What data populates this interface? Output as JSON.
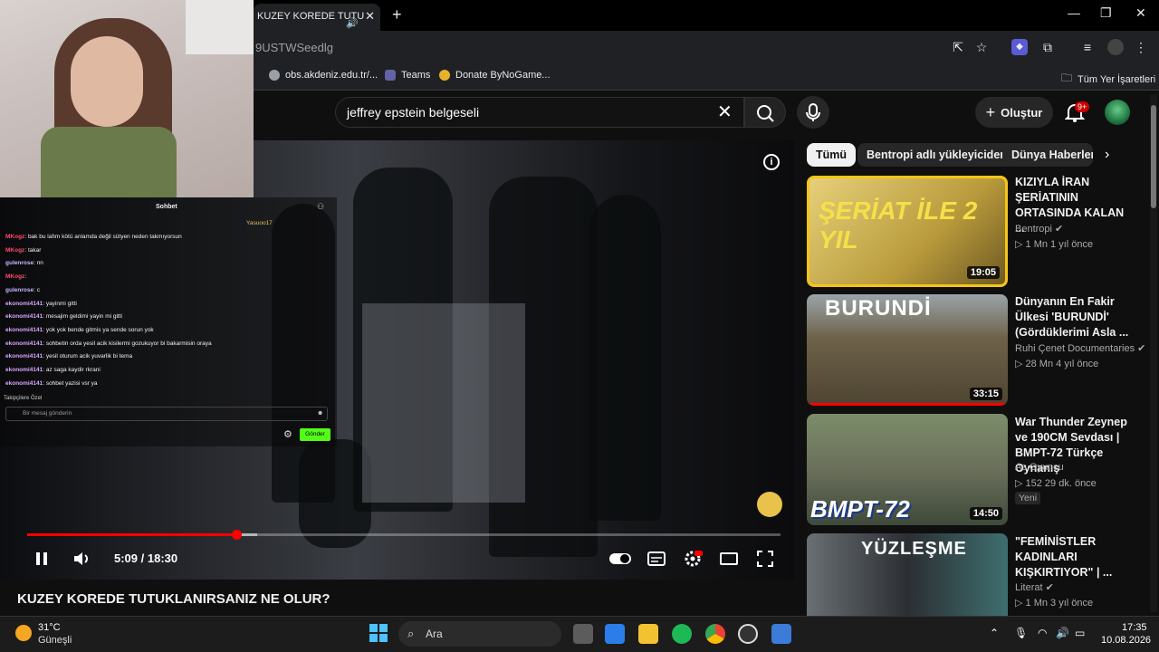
{
  "browser": {
    "tab_title": "KUZEY KOREDE TUTU",
    "url_fragment": "9USTWSeedlg",
    "bookmarks": [
      "obs.akdeniz.edu.tr/...",
      "Teams",
      "Donate ByNoGame..."
    ],
    "all_bookmarks": "Tüm Yer İşaretleri"
  },
  "youtube": {
    "search_query": "jeffrey epstein belgeseli",
    "create_label": "Oluştur",
    "notification_badge": "9+",
    "filter_chips": [
      "Tümü",
      "Bentropi adlı yükleyiciden",
      "Dünya Haberleri"
    ]
  },
  "player": {
    "current_time": "5:09 / 18:30",
    "progress_fraction": 0.278,
    "buffer_fraction": 0.305,
    "video_title": "KUZEY KOREDE TUTUKLANIRSANIZ NE OLUR?"
  },
  "chat": {
    "title": "Sohbet",
    "badge_user": "Yasuoo17",
    "messages": [
      {
        "user": "MKogz",
        "text": "bak bu lafım kötü anlamda değil sütyen neden takmıyorsun",
        "color": "#ff4d6d"
      },
      {
        "user": "MKogz",
        "text": "takar",
        "color": "#ff4d6d"
      },
      {
        "user": "gulenrose",
        "text": "nn",
        "color": "#c7b8ff"
      },
      {
        "user": "MKogz",
        "text": "",
        "color": "#ff4d6d"
      },
      {
        "user": "gulenrose",
        "text": "c",
        "color": "#c7b8ff"
      },
      {
        "user": "ekonomi4141",
        "text": "yayinmi gitti",
        "color": "#d8a6ff"
      },
      {
        "user": "ekonomi4141",
        "text": "mesajim geldimi yayin mi gitti",
        "color": "#d8a6ff"
      },
      {
        "user": "ekonomi4141",
        "text": "yok yok bende gitmis ya sende sorun yok",
        "color": "#d8a6ff"
      },
      {
        "user": "ekonomi4141",
        "text": "sohbetin orda yesil acik kisilermi gozukuyor bi bakarmisin oraya",
        "color": "#d8a6ff"
      },
      {
        "user": "ekonomi4141",
        "text": "yesil oturum acik yuvarlik bi tema",
        "color": "#d8a6ff"
      },
      {
        "user": "ekonomi4141",
        "text": "az saga kaydir rkrani",
        "color": "#d8a6ff"
      },
      {
        "user": "ekonomi4141",
        "text": "sohbet yazisi vsr ya",
        "color": "#d8a6ff"
      }
    ],
    "follower_note": "Takipçilere Özel",
    "input_placeholder": "Bir mesaj gönderin",
    "send_label": "Gönder"
  },
  "recommendations": [
    {
      "title": "KIZIYLA İRAN ŞERİATININ ORTASINDA KALAN ...",
      "channel": "Bentropi",
      "verified": true,
      "meta": "1 Mn   1 yıl önce",
      "duration": "19:05",
      "thumb_text": "ŞERİAT İLE 2 YIL",
      "new": ""
    },
    {
      "title": "Dünyanın En Fakir Ülkesi 'BURUNDİ' (Gördüklerimi Asla ...",
      "channel": "Ruhi Çenet Documentaries",
      "verified": true,
      "meta": "28 Mn   4 yıl önce",
      "duration": "33:15",
      "thumb_text": "BURUNDİ",
      "new": ""
    },
    {
      "title": "War Thunder Zeynep ve 190CM Sevdası | BMPT-72 Türkçe Oynanış",
      "channel": "As Oyuncu",
      "verified": false,
      "meta": "152   29 dk. önce",
      "duration": "14:50",
      "thumb_text": "BMPT-72",
      "new": "Yeni"
    },
    {
      "title": "\"FEMİNİSTLER KADINLARI KIŞKIRTIYOR\" | ...",
      "channel": "Literat",
      "verified": true,
      "meta": "1 Mn   3 yıl önce",
      "duration": "",
      "thumb_text": "YÜZLEŞME",
      "new": ""
    }
  ],
  "taskbar": {
    "temperature": "31°C",
    "weather": "Güneşli",
    "search_label": "Ara",
    "time": "17:35",
    "date": "10.08.2026"
  },
  "colors": {
    "youtube_red": "#ff0000",
    "chat_send_green": "#53fc18",
    "active_thumb_border": "#f5c518"
  }
}
